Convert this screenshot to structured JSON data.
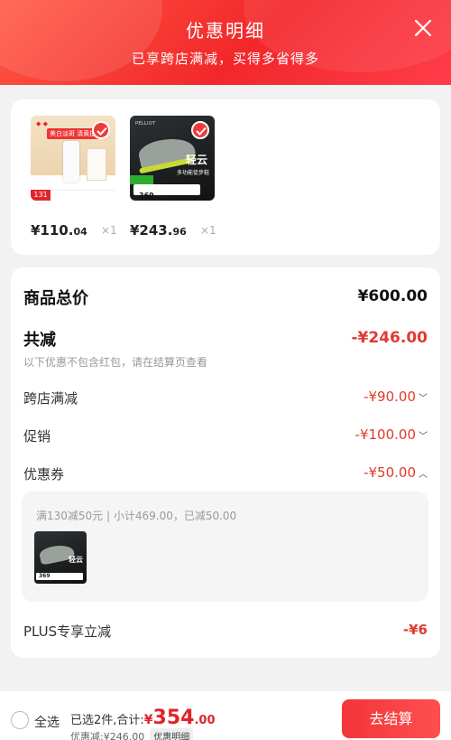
{
  "header": {
    "title": "优惠明细",
    "subtitle": "已享跨店满减，买得多省得多",
    "close_icon": "close-icon"
  },
  "products": [
    {
      "price_int": "¥110.",
      "price_dec": "04",
      "qty": "×1",
      "badge": "美白淡斑 清黄提亮",
      "sticker": "131"
    },
    {
      "price_int": "¥243.",
      "price_dec": "96",
      "qty": "×1",
      "brand": "PELLIOT",
      "name": "轻云",
      "sub": "多功能徒步鞋",
      "promo": "369"
    }
  ],
  "detail": {
    "total_label": "商品总价",
    "total_value": "¥600.00",
    "discount_label": "共减",
    "discount_value": "-¥246.00",
    "discount_note": "以下优惠不包含红包，请在结算页查看",
    "rows": [
      {
        "label": "跨店满减",
        "value": "-¥90.00",
        "chevron": "﹀"
      },
      {
        "label": "促销",
        "value": "-¥100.00",
        "chevron": "﹀"
      },
      {
        "label": "优惠券",
        "value": "-¥50.00",
        "chevron": "︿"
      }
    ],
    "coupon_text": "满130减50元 | 小计469.00，已减50.00",
    "plus_label": "PLUS专享立减",
    "plus_value": "-¥6"
  },
  "bottom": {
    "select_all": "全选",
    "selected_prefix": "已选2件,合计:",
    "currency": "¥",
    "total_int": "354",
    "total_dec": ".00",
    "discounted_text": "优惠减:¥246.00",
    "detail_link": "优惠明细",
    "checkout_label": "去结算"
  },
  "colors": {
    "accent": "#f2272a",
    "discount": "#e03a2e"
  }
}
